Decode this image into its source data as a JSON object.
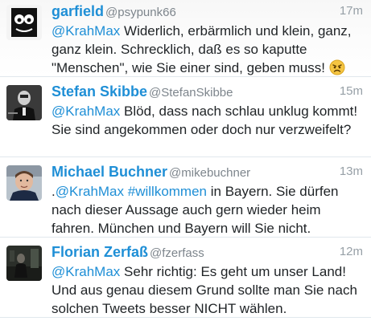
{
  "tweets": [
    {
      "name": "garfield",
      "handle": "@psypunk66",
      "time": "17m",
      "mention": "@KrahMax",
      "text": " Widerlich, erbärmlich und klein, ganz, ganz klein. Schrecklich, daß es so kaputte \"Menschen\", wie Sie einer sind, geben muss! ",
      "emoji": "angry-face"
    },
    {
      "name": "Stefan Skibbe",
      "handle": "@StefanSkibbe",
      "time": "15m",
      "mention": "@KrahMax",
      "text": " Blöd, dass nach schlau unklug kommt! Sie sind angekommen oder doch nur verzweifelt?"
    },
    {
      "name": "Michael Buchner",
      "handle": "@mikebuchner",
      "time": "13m",
      "prefix": ".",
      "mention": "@KrahMax",
      "hashtag": " #willkommen",
      "text": " in Bayern. Sie dürfen nach dieser Aussage auch gern wieder heim fahren. München und Bayern will Sie nicht."
    },
    {
      "name": "Florian Zerfaß",
      "handle": "@fzerfass",
      "time": "12m",
      "mention": "@KrahMax",
      "text": " Sehr richtig: Es geht um unser Land! Und aus genau diesem Grund sollte man Sie nach solchen Tweets besser NICHT wählen."
    }
  ],
  "colors": {
    "link": "#1f8fd6",
    "name": "#1f8fd6",
    "muted": "#7d858c"
  }
}
